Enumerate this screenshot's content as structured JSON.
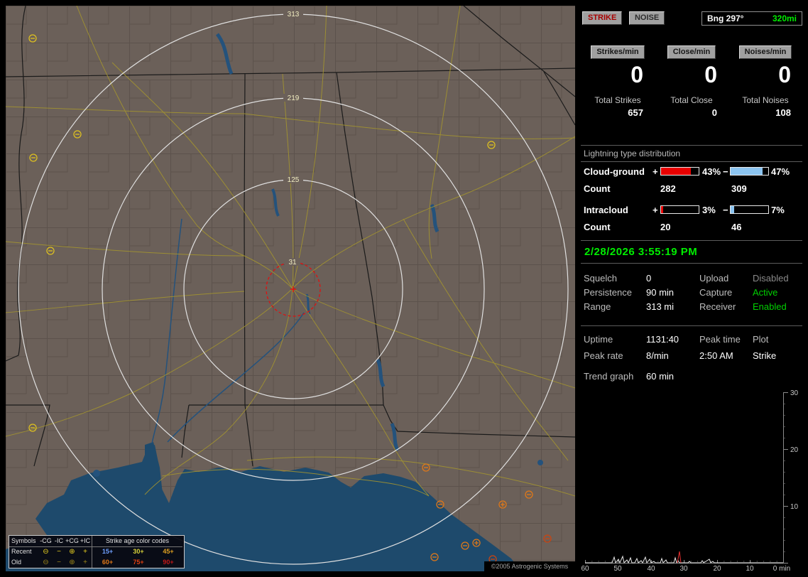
{
  "map": {
    "ring_labels": [
      "313",
      "219",
      "125",
      "31"
    ],
    "copyright": "©2005 Astrogenic Systems",
    "legend": {
      "symbols_header": "Symbols",
      "symbol_cols": [
        "-CG",
        "-IC",
        "+CG",
        "+IC"
      ],
      "age_header": "Strike age color codes",
      "row_labels": [
        "Recent",
        "Old"
      ],
      "symbols": [
        "⊖",
        "−",
        "⊕",
        "+"
      ],
      "recent_ages": [
        {
          "text": "15+",
          "color": "#6f9fff"
        },
        {
          "text": "30+",
          "color": "#d8d23a"
        },
        {
          "text": "45+",
          "color": "#e0a020"
        }
      ],
      "old_ages": [
        {
          "text": "60+",
          "color": "#e07818"
        },
        {
          "text": "75+",
          "color": "#e04010"
        },
        {
          "text": "90+",
          "color": "#c01818"
        }
      ]
    }
  },
  "panel": {
    "strike_button": "STRIKE",
    "noise_button": "NOISE",
    "bearing": "Bng 297°",
    "bearing_range": "320mi",
    "rate_columns": [
      {
        "button": "Strikes/min",
        "rate": "0",
        "total_label": "Total Strikes",
        "total_value": "657"
      },
      {
        "button": "Close/min",
        "rate": "0",
        "total_label": "Total Close",
        "total_value": "0"
      },
      {
        "button": "Noises/min",
        "rate": "0",
        "total_label": "Total Noises",
        "total_value": "108"
      }
    ],
    "distribution": {
      "title": "Lightning type distribution",
      "count_label": "Count",
      "cloud_ground": {
        "name": "Cloud-ground",
        "plus": "+",
        "minus": "−",
        "pos_pct": "43%",
        "neg_pct": "47%",
        "pos_count": "282",
        "neg_count": "309",
        "pos_fill": 80,
        "neg_fill": 84
      },
      "intracloud": {
        "name": "Intracloud",
        "plus": "+",
        "minus": "−",
        "pos_pct": "3%",
        "neg_pct": "7%",
        "pos_count": "20",
        "neg_count": "46",
        "pos_fill": 5,
        "neg_fill": 9
      }
    },
    "datetime": "2/28/2026 3:55:19 PM",
    "settings": {
      "squelch_label": "Squelch",
      "squelch": "0",
      "persistence_label": "Persistence",
      "persistence": "90 min",
      "range_label": "Range",
      "range": "313 mi",
      "upload_label": "Upload",
      "upload": "Disabled",
      "capture_label": "Capture",
      "capture": "Active",
      "receiver_label": "Receiver",
      "receiver": "Enabled"
    },
    "stats": {
      "uptime_label": "Uptime",
      "uptime": "1131:40",
      "peak_time_label": "Peak time",
      "peak_time": "2:50 AM",
      "plot_label": "Plot",
      "plot": "Strike",
      "peak_rate_label": "Peak rate",
      "peak_rate": "8/min"
    },
    "trend": {
      "label": "Trend graph",
      "window": "60 min",
      "y_ticks": [
        "30",
        "20",
        "10"
      ],
      "x_ticks": [
        "60",
        "50",
        "40",
        "30",
        "20",
        "10"
      ],
      "x_end": "0 min"
    },
    "colors": {
      "accent_green": "#00ee00",
      "accent_red": "#e00000",
      "cg_pos_bar": "#e80000",
      "cg_neg_bar": "#8cc4f0"
    }
  }
}
